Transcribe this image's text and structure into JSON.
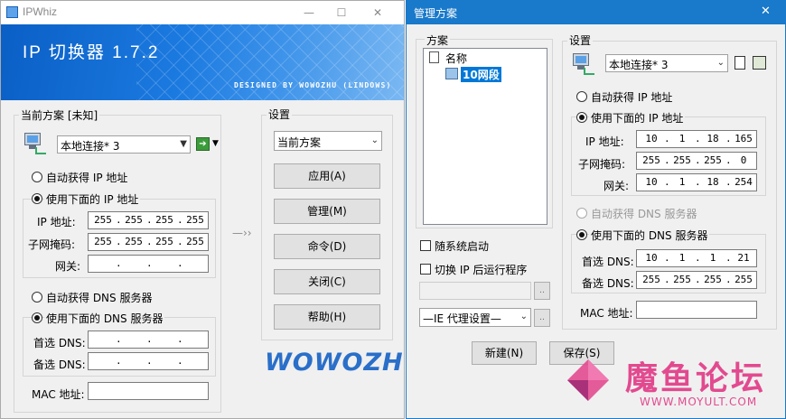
{
  "left_window": {
    "title": "IPWhiz",
    "banner_title": "IP 切换器 1.7.2",
    "banner_subtitle": "DESIGNED BY WOWOZHU (LINDOWS)",
    "scheme_group": "当前方案 [未知]",
    "adapter": "本地连接* 3",
    "auto_ip": "自动获得 IP 地址",
    "manual_ip": "使用下面的 IP 地址",
    "ip_label": "IP 地址:",
    "mask_label": "子网掩码:",
    "gateway_label": "网关:",
    "ip_value": [
      "255",
      "255",
      "255",
      "255"
    ],
    "mask_value": [
      "255",
      "255",
      "255",
      "255"
    ],
    "auto_dns": "自动获得 DNS 服务器",
    "manual_dns": "使用下面的 DNS 服务器",
    "dns1_label": "首选 DNS:",
    "dns2_label": "备选 DNS:",
    "mac_label": "MAC 地址:",
    "arrow": "—››",
    "settings_group": "设置",
    "settings_combo": "当前方案",
    "buttons": {
      "apply": "应用(A)",
      "manage": "管理(M)",
      "command": "命令(D)",
      "close": "关闭(C)",
      "help": "帮助(H)"
    },
    "logo": "WOWOZHU",
    "controls": {
      "minimize": "—",
      "maximize": "☐",
      "close": "✕"
    }
  },
  "right_window": {
    "title": "管理方案",
    "close": "✕",
    "scheme_group": "方案",
    "tree_root": "名称",
    "tree_item": "10网段",
    "startup_check": "随系统启动",
    "run_after_check": "切换 IP 后运行程序",
    "browse": "..",
    "proxy_combo": "—IE 代理设置—",
    "proxy_btn": "..",
    "new_btn": "新建(N)",
    "save_btn": "保存(S)",
    "settings_group": "设置",
    "adapter": "本地连接* 3",
    "auto_ip": "自动获得 IP 地址",
    "manual_ip": "使用下面的 IP 地址",
    "ip_label": "IP 地址:",
    "mask_label": "子网掩码:",
    "gateway_label": "网关:",
    "ip_value": [
      "10",
      "1",
      "18",
      "165"
    ],
    "mask_value": [
      "255",
      "255",
      "255",
      "0"
    ],
    "gateway_value": [
      "10",
      "1",
      "18",
      "254"
    ],
    "auto_dns": "自动获得 DNS 服务器",
    "manual_dns": "使用下面的 DNS 服务器",
    "dns1_label": "首选 DNS:",
    "dns2_label": "备选 DNS:",
    "dns1_value": [
      "10",
      "1",
      "1",
      "21"
    ],
    "dns2_value": [
      "255",
      "255",
      "255",
      "255"
    ],
    "mac_label": "MAC 地址:"
  },
  "watermark": {
    "text": "魔鱼论坛",
    "url": "WWW.MOYULT.COM"
  },
  "colors": {
    "accent": "#1979ca",
    "banner": "#1b7ae0",
    "logo": "#2a6fc9",
    "watermark": "#e24a8f"
  }
}
